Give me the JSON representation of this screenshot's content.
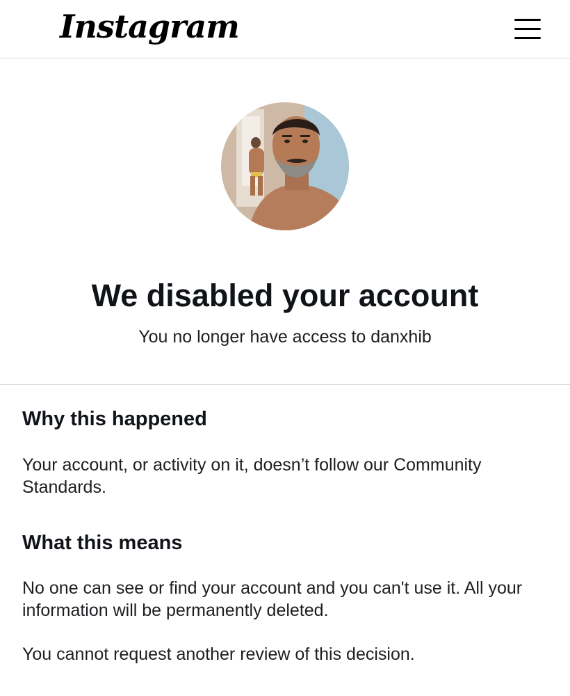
{
  "header": {
    "logo_text": "Instagram",
    "menu_icon": "hamburger-menu-icon"
  },
  "account": {
    "title": "We disabled your account",
    "subtitle": "You no longer have access to danxhib"
  },
  "why": {
    "heading": "Why this happened",
    "text": "Your account, or activity on it, doesn’t follow our Community Standards."
  },
  "means": {
    "heading": "What this means",
    "text": "No one can see or find your account and you can't use it. All your information will be permanently deleted.",
    "note": "You cannot request another review of this decision."
  }
}
